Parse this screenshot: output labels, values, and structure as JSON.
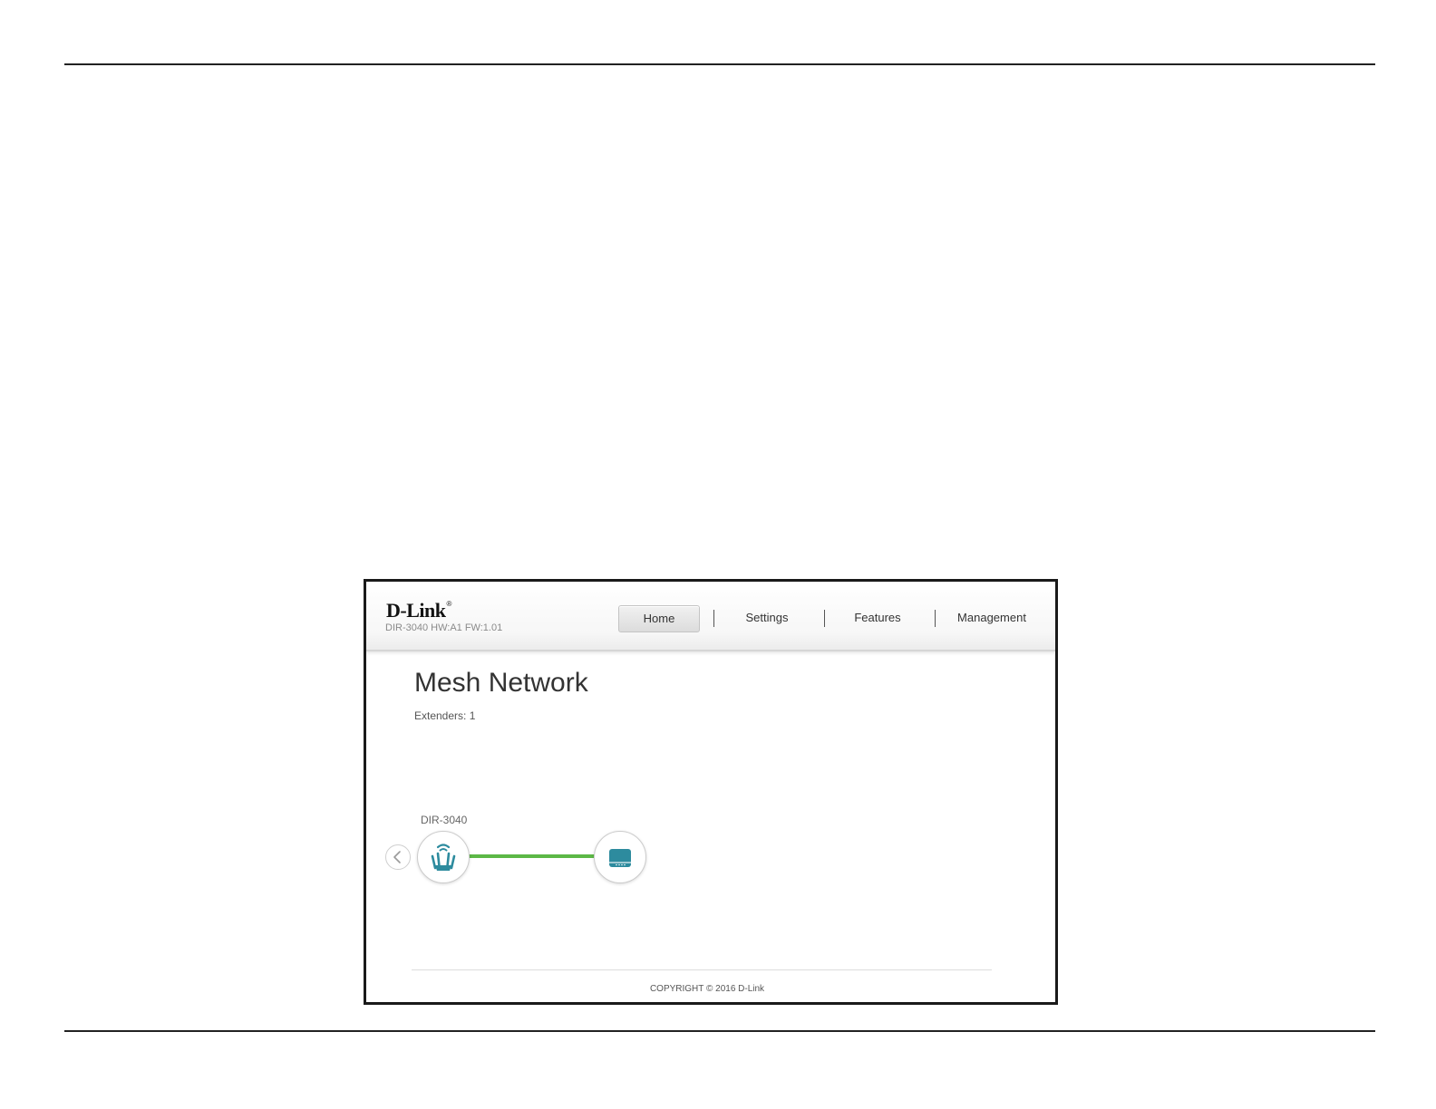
{
  "header": {
    "brand": "D-Link",
    "brand_mark": "®",
    "device_info": "DIR-3040 HW:A1 FW:1.01"
  },
  "nav": {
    "items": [
      {
        "label": "Home",
        "active": true
      },
      {
        "label": "Settings",
        "active": false
      },
      {
        "label": "Features",
        "active": false
      },
      {
        "label": "Management",
        "active": false
      }
    ]
  },
  "main": {
    "title": "Mesh Network",
    "extenders_text": "Extenders: 1"
  },
  "topology": {
    "router_label": "DIR-3040",
    "router_icon": "router-icon",
    "extender_icon": "extender-icon",
    "prev_icon": "chevron-left-icon",
    "link_color": "#5cb846",
    "icon_color": "#2d8b9e"
  },
  "footer": {
    "copyright": "COPYRIGHT © 2016 D-Link"
  }
}
